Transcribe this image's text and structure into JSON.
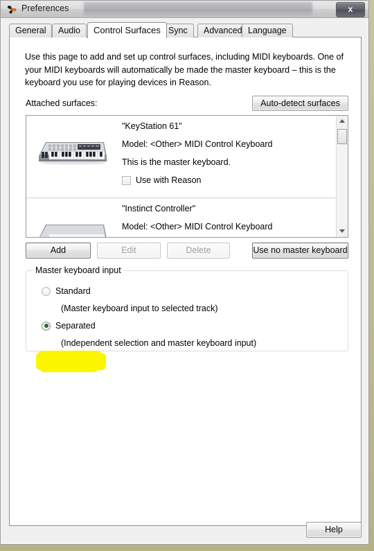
{
  "window": {
    "title": "Preferences",
    "icon": "propeller-logo-icon",
    "close_label": "x"
  },
  "tabs": [
    {
      "label": "General",
      "active": false
    },
    {
      "label": "Audio",
      "active": false
    },
    {
      "label": "Control Surfaces",
      "active": true
    },
    {
      "label": "Sync",
      "active": false
    },
    {
      "label": "Advanced",
      "active": false
    },
    {
      "label": "Language",
      "active": false
    }
  ],
  "page": {
    "intro": "Use this page to add and set up control surfaces, including MIDI keyboards. One of your MIDI keyboards will automatically be made the master keyboard – this is the keyboard you use for playing devices in Reason.",
    "attached_label": "Attached surfaces:",
    "auto_detect_label": "Auto-detect surfaces"
  },
  "surfaces": [
    {
      "name": "\"KeyStation 61\"",
      "model": "Model: <Other> MIDI Control Keyboard",
      "note": "This is the master keyboard.",
      "checkbox_label": "Use with Reason",
      "checked": false,
      "thumbnail": "midi-keyboard-image"
    },
    {
      "name": "\"Instinct Controller\"",
      "model": "Model: <Other> MIDI Control Keyboard",
      "note": "",
      "checkbox_label": "",
      "checked": false,
      "thumbnail": "midi-keyboard-image"
    }
  ],
  "actions": {
    "add_label": "Add",
    "edit_label": "Edit",
    "edit_disabled": true,
    "delete_label": "Delete",
    "delete_disabled": true,
    "no_master_label": "Use no master keyboard"
  },
  "master_keyboard_input": {
    "group_title": "Master keyboard input",
    "options": [
      {
        "label": "Standard",
        "description": "(Master keyboard input to selected track)",
        "selected": false,
        "highlighted": false
      },
      {
        "label": "Separated",
        "description": "(Independent selection and master keyboard input)",
        "selected": true,
        "highlighted": true
      }
    ],
    "highlight_color": "#fcf500",
    "selected_dot_color": "#18762c"
  },
  "footer": {
    "help_label": "Help"
  }
}
